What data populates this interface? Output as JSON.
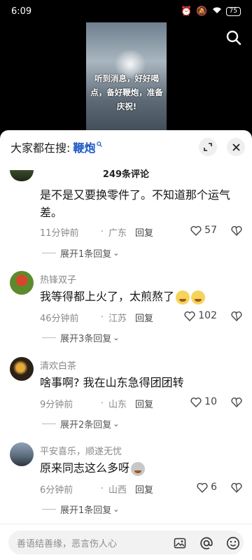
{
  "status": {
    "time": "6:09",
    "battery": "75"
  },
  "video": {
    "caption": "听到消息，好好喝点，备好鞭炮，准备庆祝!"
  },
  "search": {
    "prefix": "大家都在搜:",
    "term": "鞭炮",
    "suffix_icon": "search-mini-icon"
  },
  "comments_header": {
    "count_label": "249条评论"
  },
  "comments": [
    {
      "username": "",
      "content": "是不是又要换零件了。不知道那个运气差。",
      "time": "11分钟前",
      "region": "广东",
      "reply_label": "回复",
      "likes": "57",
      "expand_label": "展开1条回复"
    },
    {
      "username": "热锋双子",
      "content": "我等得都上火了，太煎熬了",
      "emoji": [
        "crying-face-emoji",
        "crying-face-emoji"
      ],
      "time": "46分钟前",
      "region": "江苏",
      "reply_label": "回复",
      "likes": "102",
      "expand_label": "展开3条回复"
    },
    {
      "username": "清欢白茶",
      "content": "啥事啊? 我在山东急得团团转",
      "time": "9分钟前",
      "region": "山东",
      "reply_label": "回复",
      "likes": "10",
      "expand_label": "展开2条回复"
    },
    {
      "username": "平安喜乐，顺遂无忧",
      "content": "原来同志这么多呀",
      "emoji": [
        "cat-emoji"
      ],
      "time": "6分钟前",
      "region": "山西",
      "reply_label": "回复",
      "likes": "6",
      "expand_label": "展开1条回复"
    }
  ],
  "input_bar": {
    "placeholder": "善语结善缘，恶言伤人心"
  },
  "colors": {
    "accent": "#1a57c4",
    "sheet_bg": "#ffffff",
    "screen_bg": "#000000"
  }
}
